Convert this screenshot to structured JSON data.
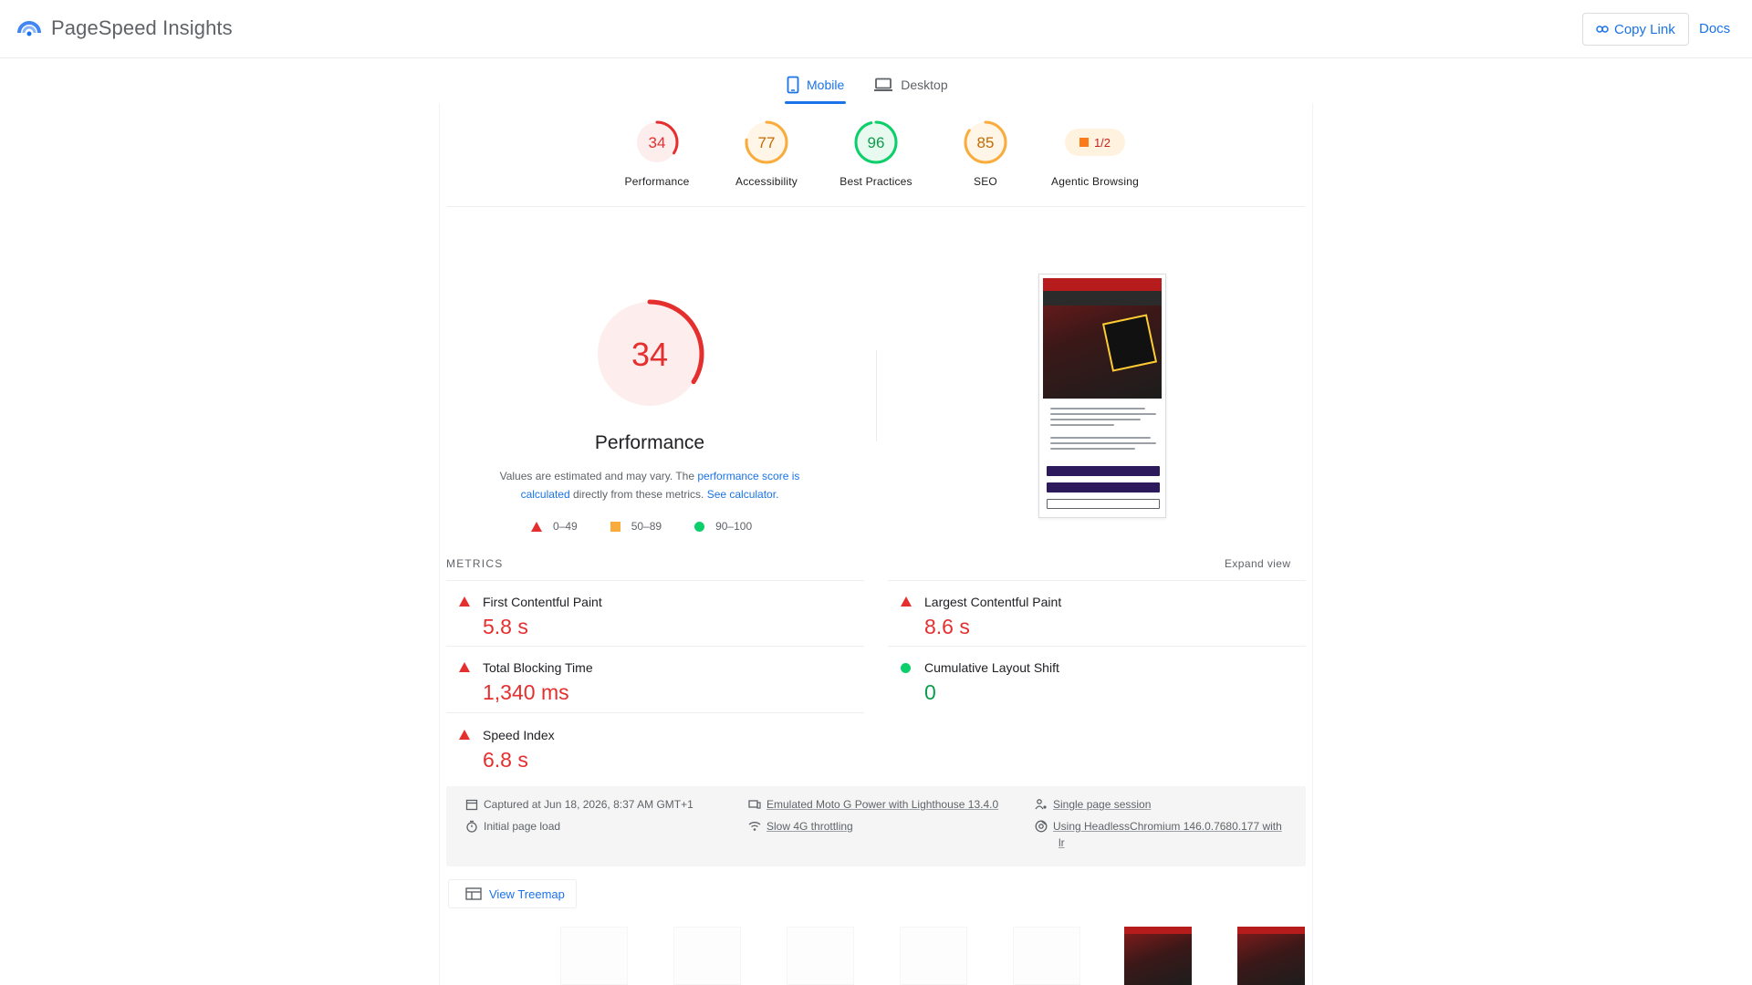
{
  "header": {
    "app_name": "PageSpeed Insights",
    "copy_link_label": "Copy Link",
    "docs_label": "Docs"
  },
  "tabs": [
    {
      "label": "Mobile",
      "active": true,
      "icon": "phone-icon"
    },
    {
      "label": "Desktop",
      "active": false,
      "icon": "laptop-icon"
    }
  ],
  "categories": [
    {
      "label": "Performance",
      "score": 34,
      "rating": "fail",
      "color": "#e52f2f"
    },
    {
      "label": "Accessibility",
      "score": 77,
      "rating": "average",
      "color": "#f9ab3c"
    },
    {
      "label": "Best Practices",
      "score": 96,
      "rating": "pass",
      "color": "#0cce6b"
    },
    {
      "label": "SEO",
      "score": 85,
      "rating": "average",
      "color": "#f9ab3c"
    },
    {
      "label": "Agentic Browsing",
      "score_text": "1/2",
      "rating": "average",
      "color": "#fa7b17"
    }
  ],
  "performance": {
    "score": 34,
    "title": "Performance",
    "desc_prefix": "Values are estimated and may vary. The ",
    "desc_link1": "performance score is calculated",
    "desc_middle": " directly from these metrics. ",
    "desc_link2": "See calculator.",
    "legend": [
      {
        "label": "0–49",
        "icon": "red-triangle-icon"
      },
      {
        "label": "50–89",
        "icon": "orange-square-icon"
      },
      {
        "label": "90–100",
        "icon": "green-circle-icon"
      }
    ]
  },
  "metrics": {
    "heading": "METRICS",
    "expand_label": "Expand view",
    "items": [
      {
        "name": "First Contentful Paint",
        "value": "5.8 s",
        "rating": "fail"
      },
      {
        "name": "Largest Contentful Paint",
        "value": "8.6 s",
        "rating": "fail"
      },
      {
        "name": "Total Blocking Time",
        "value": "1,340 ms",
        "rating": "fail"
      },
      {
        "name": "Cumulative Layout Shift",
        "value": "0",
        "rating": "pass"
      },
      {
        "name": "Speed Index",
        "value": "6.8 s",
        "rating": "fail"
      }
    ]
  },
  "capture_info": {
    "captured": "Captured at Jun 18, 2026, 8:37 AM GMT+1",
    "initial_load": "Initial page load",
    "device": "Emulated Moto G Power with Lighthouse 13.4.0",
    "throttling": "Slow 4G throttling",
    "session": "Single page session",
    "browser": "Using HeadlessChromium 146.0.7680.177 with",
    "browser_cont": "lr"
  },
  "treemap_label": "View Treemap",
  "colors": {
    "fail": "#e52f2f",
    "average": "#f9ab3c",
    "pass": "#0cce6b",
    "link": "#1a73e8"
  }
}
